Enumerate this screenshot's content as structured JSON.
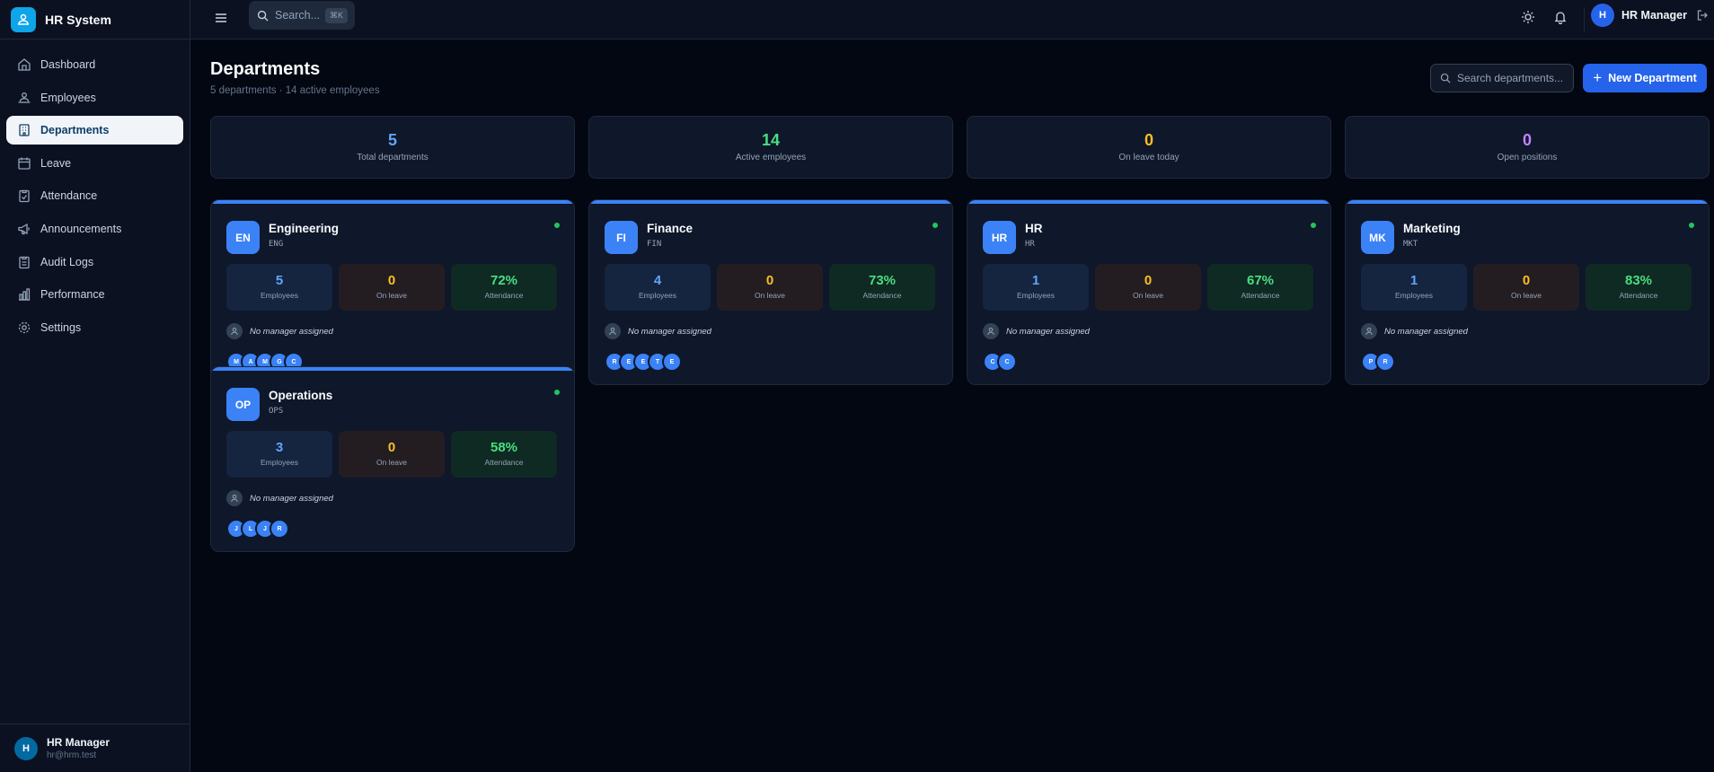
{
  "app": {
    "name": "HR System"
  },
  "sidebar": {
    "items": [
      {
        "label": "Dashboard",
        "icon": "home-icon"
      },
      {
        "label": "Employees",
        "icon": "users-icon"
      },
      {
        "label": "Departments",
        "icon": "building-icon",
        "active": true
      },
      {
        "label": "Leave",
        "icon": "calendar-icon"
      },
      {
        "label": "Attendance",
        "icon": "clipboard-check-icon"
      },
      {
        "label": "Announcements",
        "icon": "megaphone-icon"
      },
      {
        "label": "Audit Logs",
        "icon": "clipboard-list-icon"
      },
      {
        "label": "Performance",
        "icon": "bar-chart-icon"
      },
      {
        "label": "Settings",
        "icon": "gear-icon"
      }
    ],
    "user": {
      "initial": "H",
      "name": "HR Manager",
      "email": "hr@hrm.test"
    }
  },
  "topbar": {
    "search_label": "Search...",
    "search_kbd": "⌘K",
    "user": {
      "initial": "H",
      "name": "HR Manager"
    }
  },
  "page": {
    "title": "Departments",
    "subtitle": "5 departments · 14 active employees",
    "search_placeholder": "Search departments...",
    "new_button": "New Department"
  },
  "stats": [
    {
      "value": "5",
      "label": "Total departments",
      "color": "#60a5fa"
    },
    {
      "value": "14",
      "label": "Active employees",
      "color": "#4ade80"
    },
    {
      "value": "0",
      "label": "On leave today",
      "color": "#fbbf24"
    },
    {
      "value": "0",
      "label": "Open positions",
      "color": "#c084fc"
    }
  ],
  "box_labels": {
    "employees": "Employees",
    "on_leave": "On leave",
    "attendance": "Attendance"
  },
  "departments": [
    {
      "initials": "EN",
      "name": "Engineering",
      "code": "ENG",
      "employees": "5",
      "on_leave": "0",
      "attendance": "72%",
      "manager": "No manager assigned",
      "members": [
        "M",
        "A",
        "M",
        "G",
        "C"
      ]
    },
    {
      "initials": "FI",
      "name": "Finance",
      "code": "FIN",
      "employees": "4",
      "on_leave": "0",
      "attendance": "73%",
      "manager": "No manager assigned",
      "members": [
        "R",
        "E",
        "E",
        "T",
        "E"
      ]
    },
    {
      "initials": "HR",
      "name": "HR",
      "code": "HR",
      "employees": "1",
      "on_leave": "0",
      "attendance": "67%",
      "manager": "No manager assigned",
      "members": [
        "C",
        "C"
      ]
    },
    {
      "initials": "MK",
      "name": "Marketing",
      "code": "MKT",
      "employees": "1",
      "on_leave": "0",
      "attendance": "83%",
      "manager": "No manager assigned",
      "members": [
        "P",
        "R"
      ]
    },
    {
      "initials": "OP",
      "name": "Operations",
      "code": "OPS",
      "employees": "3",
      "on_leave": "0",
      "attendance": "58%",
      "manager": "No manager assigned",
      "members": [
        "J",
        "L",
        "J",
        "R"
      ]
    }
  ]
}
